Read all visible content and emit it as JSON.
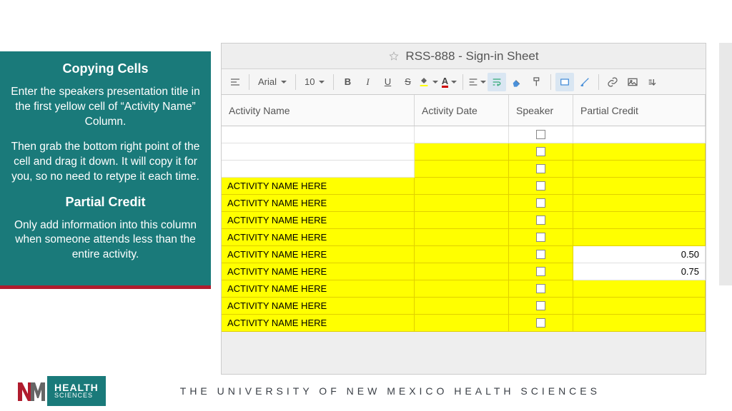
{
  "sidebar": {
    "heading1": "Copying Cells",
    "para1": "Enter the speakers presentation title in the  first yellow cell of “Activity Name” Column.",
    "para2": "Then grab the bottom right point of the cell and drag it down.  It will copy it for you, so no need to retype it each time.",
    "heading2": "Partial Credit",
    "para3": "Only add information into this column when someone attends less than the entire activity."
  },
  "sheet": {
    "title": "RSS-888 - Sign-in Sheet",
    "font": "Arial",
    "size": "10",
    "headers": {
      "activity_name": "Activity Name",
      "activity_date": "Activity Date",
      "speaker": "Speaker",
      "partial_credit": "Partial Credit"
    },
    "rows": [
      {
        "act": "",
        "act_y": false,
        "date": "",
        "date_y": false,
        "spk_y": false,
        "spk_check": true,
        "pc": "",
        "pc_y": false
      },
      {
        "act": "",
        "act_y": false,
        "date": "",
        "date_y": true,
        "spk_y": true,
        "spk_check": true,
        "pc": "",
        "pc_y": true
      },
      {
        "act": "",
        "act_y": false,
        "date": "",
        "date_y": true,
        "spk_y": true,
        "spk_check": true,
        "pc": "",
        "pc_y": true
      },
      {
        "act": "ACTIVITY NAME HERE",
        "act_y": true,
        "date": "",
        "date_y": true,
        "spk_y": true,
        "spk_check": true,
        "pc": "",
        "pc_y": true
      },
      {
        "act": "ACTIVITY NAME HERE",
        "act_y": true,
        "date": "",
        "date_y": true,
        "spk_y": true,
        "spk_check": true,
        "pc": "",
        "pc_y": true
      },
      {
        "act": "ACTIVITY NAME HERE",
        "act_y": true,
        "date": "",
        "date_y": true,
        "spk_y": true,
        "spk_check": true,
        "pc": "",
        "pc_y": true
      },
      {
        "act": "ACTIVITY NAME HERE",
        "act_y": true,
        "date": "",
        "date_y": true,
        "spk_y": true,
        "spk_check": true,
        "pc": "",
        "pc_y": true
      },
      {
        "act": "ACTIVITY NAME HERE",
        "act_y": true,
        "date": "",
        "date_y": true,
        "spk_y": true,
        "spk_check": true,
        "pc": "0.50",
        "pc_y": false
      },
      {
        "act": "ACTIVITY NAME HERE",
        "act_y": true,
        "date": "",
        "date_y": true,
        "spk_y": true,
        "spk_check": true,
        "pc": "0.75",
        "pc_y": false
      },
      {
        "act": "ACTIVITY NAME HERE",
        "act_y": true,
        "date": "",
        "date_y": true,
        "spk_y": true,
        "spk_check": true,
        "pc": "",
        "pc_y": true
      },
      {
        "act": "ACTIVITY NAME HERE",
        "act_y": true,
        "date": "",
        "date_y": true,
        "spk_y": true,
        "spk_check": true,
        "pc": "",
        "pc_y": true
      },
      {
        "act": "ACTIVITY NAME HERE",
        "act_y": true,
        "date": "",
        "date_y": true,
        "spk_y": true,
        "spk_check": true,
        "pc": "",
        "pc_y": true
      }
    ]
  },
  "footer": {
    "logo_top": "HEALTH",
    "logo_bottom": "SCIENCES",
    "text": "THE UNIVERSITY OF NEW MEXICO HEALTH SCIENCES"
  }
}
